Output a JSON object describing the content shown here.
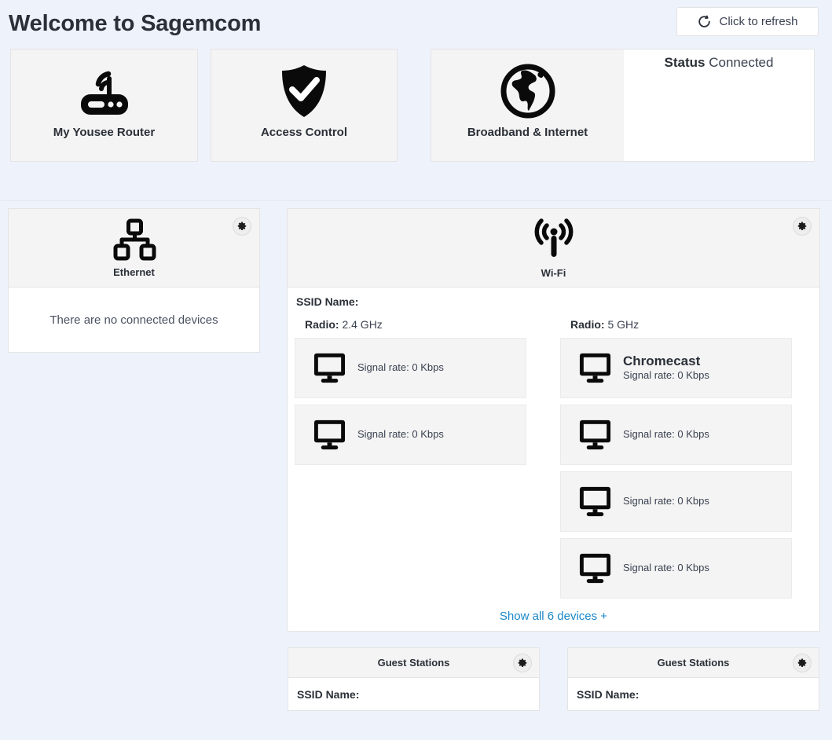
{
  "header": {
    "title": "Welcome to Sagemcom",
    "refresh_label": "Click to refresh",
    "refresh_icon": "refresh-icon"
  },
  "top_tiles": [
    {
      "label": "My Yousee Router",
      "icon": "router-icon"
    },
    {
      "label": "Access Control",
      "icon": "shield-check-icon"
    },
    {
      "label": "Broadband & Internet",
      "icon": "globe-icon"
    }
  ],
  "status_panel": {
    "key": "Status",
    "value": "Connected"
  },
  "ethernet": {
    "title": "Ethernet",
    "icon": "sitemap-icon",
    "gear_icon": "gear-icon",
    "empty_message": "There are no connected devices"
  },
  "wifi": {
    "title": "Wi-Fi",
    "icon": "wifi-broadcast-icon",
    "gear_icon": "gear-icon",
    "ssid_label": "SSID Name:",
    "radios": [
      {
        "label": "Radio:",
        "value": "2.4 GHz",
        "devices": [
          {
            "name": "",
            "rate": "Signal rate: 0 Kbps",
            "icon": "monitor-icon"
          },
          {
            "name": "",
            "rate": "Signal rate: 0 Kbps",
            "icon": "monitor-icon"
          }
        ]
      },
      {
        "label": "Radio:",
        "value": "5 GHz",
        "devices": [
          {
            "name": "Chromecast",
            "rate": "Signal rate: 0 Kbps",
            "icon": "monitor-icon"
          },
          {
            "name": "",
            "rate": "Signal rate: 0 Kbps",
            "icon": "monitor-icon"
          },
          {
            "name": "",
            "rate": "Signal rate: 0 Kbps",
            "icon": "monitor-icon"
          },
          {
            "name": "",
            "rate": "Signal rate: 0 Kbps",
            "icon": "monitor-icon"
          }
        ]
      }
    ],
    "show_all_label": "Show all 6 devices +"
  },
  "guest_stations": [
    {
      "title": "Guest Stations",
      "ssid_label": "SSID Name:",
      "gear_icon": "gear-icon"
    },
    {
      "title": "Guest Stations",
      "ssid_label": "SSID Name:",
      "gear_icon": "gear-icon"
    }
  ],
  "colors": {
    "page_background": "#eef2fb",
    "card_background": "#f4f4f4",
    "panel_background": "#ffffff",
    "link": "#1a87c8",
    "text": "#2b3038"
  }
}
